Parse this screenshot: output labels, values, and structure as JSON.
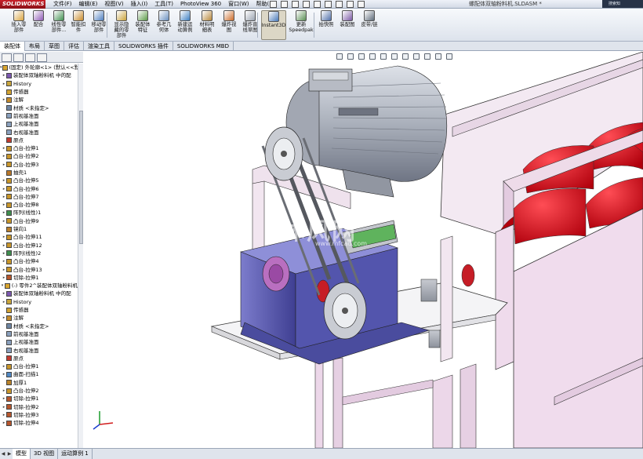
{
  "app": {
    "name": "SOLIDWORKS",
    "menus": [
      "文件(F)",
      "编辑(E)",
      "视图(V)",
      "插入(I)",
      "工具(T)",
      "PhotoView 360",
      "窗口(W)",
      "帮助(H)"
    ],
    "document_title": "螺配体双轴粉料机.SLDASM *",
    "search_placeholder": "搜索知"
  },
  "commands": [
    {
      "label": "插入零\n部件",
      "icon": "insert-component-icon",
      "color": "#d9a441"
    },
    {
      "label": "配合",
      "icon": "mate-icon",
      "color": "#8f5bb5"
    },
    {
      "label": "线性零\n部件...",
      "icon": "linear-pattern-icon",
      "color": "#3f8f4f"
    },
    {
      "label": "智能扣\n件",
      "icon": "smart-fastener-icon",
      "color": "#c98b2c"
    },
    {
      "label": "移动零\n部件",
      "icon": "move-component-icon",
      "color": "#4f7fc0"
    },
    {
      "label": "显示隐\n藏的零\n部件",
      "icon": "show-hidden-icon",
      "color": "#c9a23a"
    },
    {
      "label": "装配体\n特征",
      "icon": "assembly-feature-icon",
      "color": "#5b9a47"
    },
    {
      "label": "参考几\n何体",
      "icon": "reference-geometry-icon",
      "color": "#6a8fbf"
    },
    {
      "label": "新建运\n动算例",
      "icon": "motion-study-icon",
      "color": "#3e7fc2"
    },
    {
      "label": "材料明\n细表",
      "icon": "bom-icon",
      "color": "#b7873a"
    },
    {
      "label": "爆炸视\n图",
      "icon": "exploded-view-icon",
      "color": "#cc6c2a"
    },
    {
      "label": "爆炸直\n线草图",
      "icon": "explode-line-icon",
      "color": "#9aa3b0"
    },
    {
      "label": "Instant3D",
      "icon": "instant3d-icon",
      "color": "#4778b9",
      "active": true
    },
    {
      "label": "更新\nSpeedpak",
      "icon": "speedpak-icon",
      "color": "#5a8f55"
    },
    {
      "label": "拍快照",
      "icon": "snapshot-icon",
      "color": "#4f6fa8"
    },
    {
      "label": "装配图",
      "icon": "assembly-drawing-icon",
      "color": "#7c5aa5"
    },
    {
      "label": "皮带/链",
      "icon": "belt-chain-icon",
      "color": "#5e6b7a"
    }
  ],
  "tabs": [
    {
      "label": "装配体",
      "selected": true
    },
    {
      "label": "布局",
      "selected": false
    },
    {
      "label": "草图",
      "selected": false
    },
    {
      "label": "评估",
      "selected": false
    },
    {
      "label": "渲染工具",
      "selected": false
    },
    {
      "label": "SOLIDWORKS 插件",
      "selected": false
    },
    {
      "label": "SOLIDWORKS MBD",
      "selected": false
    }
  ],
  "feature_tree": [
    {
      "label": "(固定) 外轮廓<1> (默认<<默",
      "icon": "part-icon",
      "color": "#d8a42e",
      "expand": "-"
    },
    {
      "label": "装配体双轴粉料机 中的配",
      "icon": "mates-icon",
      "color": "#7c58b0",
      "expand": "+"
    },
    {
      "label": "History",
      "icon": "history-icon",
      "color": "#c9a53c",
      "expand": "+"
    },
    {
      "label": "传感器",
      "icon": "sensor-icon",
      "color": "#d2a231",
      "expand": ""
    },
    {
      "label": "注解",
      "icon": "annotation-icon",
      "color": "#c58c2b",
      "expand": "+"
    },
    {
      "label": "材质 <未指定>",
      "icon": "material-icon",
      "color": "#6f86a3",
      "expand": ""
    },
    {
      "label": "前视基准面",
      "icon": "plane-icon",
      "color": "#8aa0bd",
      "expand": ""
    },
    {
      "label": "上视基准面",
      "icon": "plane-icon",
      "color": "#8aa0bd",
      "expand": ""
    },
    {
      "label": "右视基准面",
      "icon": "plane-icon",
      "color": "#8aa0bd",
      "expand": ""
    },
    {
      "label": "原点",
      "icon": "origin-icon",
      "color": "#c23b2f",
      "expand": ""
    },
    {
      "label": "凸台-拉伸1",
      "icon": "extrude-icon",
      "color": "#c8962b",
      "expand": "+"
    },
    {
      "label": "凸台-拉伸2",
      "icon": "extrude-icon",
      "color": "#c8962b",
      "expand": "+"
    },
    {
      "label": "凸台-拉伸3",
      "icon": "extrude-icon",
      "color": "#c8962b",
      "expand": "+"
    },
    {
      "label": "抽壳1",
      "icon": "shell-icon",
      "color": "#b9782a",
      "expand": ""
    },
    {
      "label": "凸台-拉伸5",
      "icon": "extrude-icon",
      "color": "#c8962b",
      "expand": "+"
    },
    {
      "label": "凸台-拉伸6",
      "icon": "extrude-icon",
      "color": "#c8962b",
      "expand": "+"
    },
    {
      "label": "凸台-拉伸7",
      "icon": "extrude-icon",
      "color": "#c8962b",
      "expand": "+"
    },
    {
      "label": "凸台-拉伸8",
      "icon": "extrude-icon",
      "color": "#c8962b",
      "expand": "+"
    },
    {
      "label": "阵列(线性)1",
      "icon": "pattern-icon",
      "color": "#3f8f4f",
      "expand": "+"
    },
    {
      "label": "凸台-拉伸9",
      "icon": "extrude-icon",
      "color": "#c8962b",
      "expand": "+"
    },
    {
      "label": "镜向1",
      "icon": "mirror-icon",
      "color": "#b97f2c",
      "expand": ""
    },
    {
      "label": "凸台-拉伸11",
      "icon": "extrude-icon",
      "color": "#c8962b",
      "expand": "+"
    },
    {
      "label": "凸台-拉伸12",
      "icon": "extrude-icon",
      "color": "#c8962b",
      "expand": "+"
    },
    {
      "label": "阵列(线性)2",
      "icon": "pattern-icon",
      "color": "#3f8f4f",
      "expand": "+"
    },
    {
      "label": "凸台-拉伸4",
      "icon": "extrude-icon",
      "color": "#c8962b",
      "expand": "+"
    },
    {
      "label": "凸台-拉伸13",
      "icon": "extrude-icon",
      "color": "#c8962b",
      "expand": "+"
    },
    {
      "label": "切除-拉伸1",
      "icon": "cut-icon",
      "color": "#b7572d",
      "expand": "+"
    },
    {
      "label": "(-) 零件2^装配体双轴粉料机",
      "icon": "part-icon",
      "color": "#d8a42e",
      "expand": "-"
    },
    {
      "label": "装配体双轴粉料机 中的配",
      "icon": "mates-icon",
      "color": "#7c58b0",
      "expand": "+"
    },
    {
      "label": "History",
      "icon": "history-icon",
      "color": "#c9a53c",
      "expand": "+"
    },
    {
      "label": "传感器",
      "icon": "sensor-icon",
      "color": "#d2a231",
      "expand": ""
    },
    {
      "label": "注解",
      "icon": "annotation-icon",
      "color": "#c58c2b",
      "expand": "+"
    },
    {
      "label": "材质 <未指定>",
      "icon": "material-icon",
      "color": "#6f86a3",
      "expand": ""
    },
    {
      "label": "前视基准面",
      "icon": "plane-icon",
      "color": "#8aa0bd",
      "expand": ""
    },
    {
      "label": "上视基准面",
      "icon": "plane-icon",
      "color": "#8aa0bd",
      "expand": ""
    },
    {
      "label": "右视基准面",
      "icon": "plane-icon",
      "color": "#8aa0bd",
      "expand": ""
    },
    {
      "label": "原点",
      "icon": "origin-icon",
      "color": "#c23b2f",
      "expand": ""
    },
    {
      "label": "凸台-拉伸1",
      "icon": "extrude-icon",
      "color": "#c8962b",
      "expand": "+"
    },
    {
      "label": "曲面-扫描1",
      "icon": "surface-sweep-icon",
      "color": "#4f88c4",
      "expand": "+"
    },
    {
      "label": "加厚1",
      "icon": "thicken-icon",
      "color": "#b9822a",
      "expand": ""
    },
    {
      "label": "凸台-拉伸2",
      "icon": "extrude-icon",
      "color": "#c8962b",
      "expand": "+"
    },
    {
      "label": "切除-拉伸1",
      "icon": "cut-icon",
      "color": "#b7572d",
      "expand": "+"
    },
    {
      "label": "切除-拉伸2",
      "icon": "cut-icon",
      "color": "#b7572d",
      "expand": "+"
    },
    {
      "label": "切除-拉伸3",
      "icon": "cut-icon",
      "color": "#b7572d",
      "expand": "+"
    },
    {
      "label": "切除-拉伸4",
      "icon": "cut-icon",
      "color": "#b7572d",
      "expand": "+"
    }
  ],
  "viewport": {
    "heads_up_icons": [
      "zoom-fit-icon",
      "zoom-area-icon",
      "previous-view-icon",
      "section-view-icon",
      "dynamic-annotation-icon",
      "view-orientation-icon",
      "display-style-icon",
      "hide-show-icon",
      "edit-appearance-icon",
      "scene-icon",
      "view-settings-icon"
    ],
    "watermark": "沐风网",
    "watermark_url": "www.mfcad.com"
  },
  "bottom_tabs": [
    {
      "label": "模型",
      "selected": true
    },
    {
      "label": "3D 视图",
      "selected": false
    },
    {
      "label": "运动算例 1",
      "selected": false
    }
  ],
  "colors": {
    "accent": "#4778b9",
    "brand_red": "#c8202a",
    "motor_grey": "#b9bdc6",
    "gearbox_blue": "#5e5fb2",
    "hopper_pink": "#e8cfe6",
    "rotor_red": "#d9131f"
  }
}
